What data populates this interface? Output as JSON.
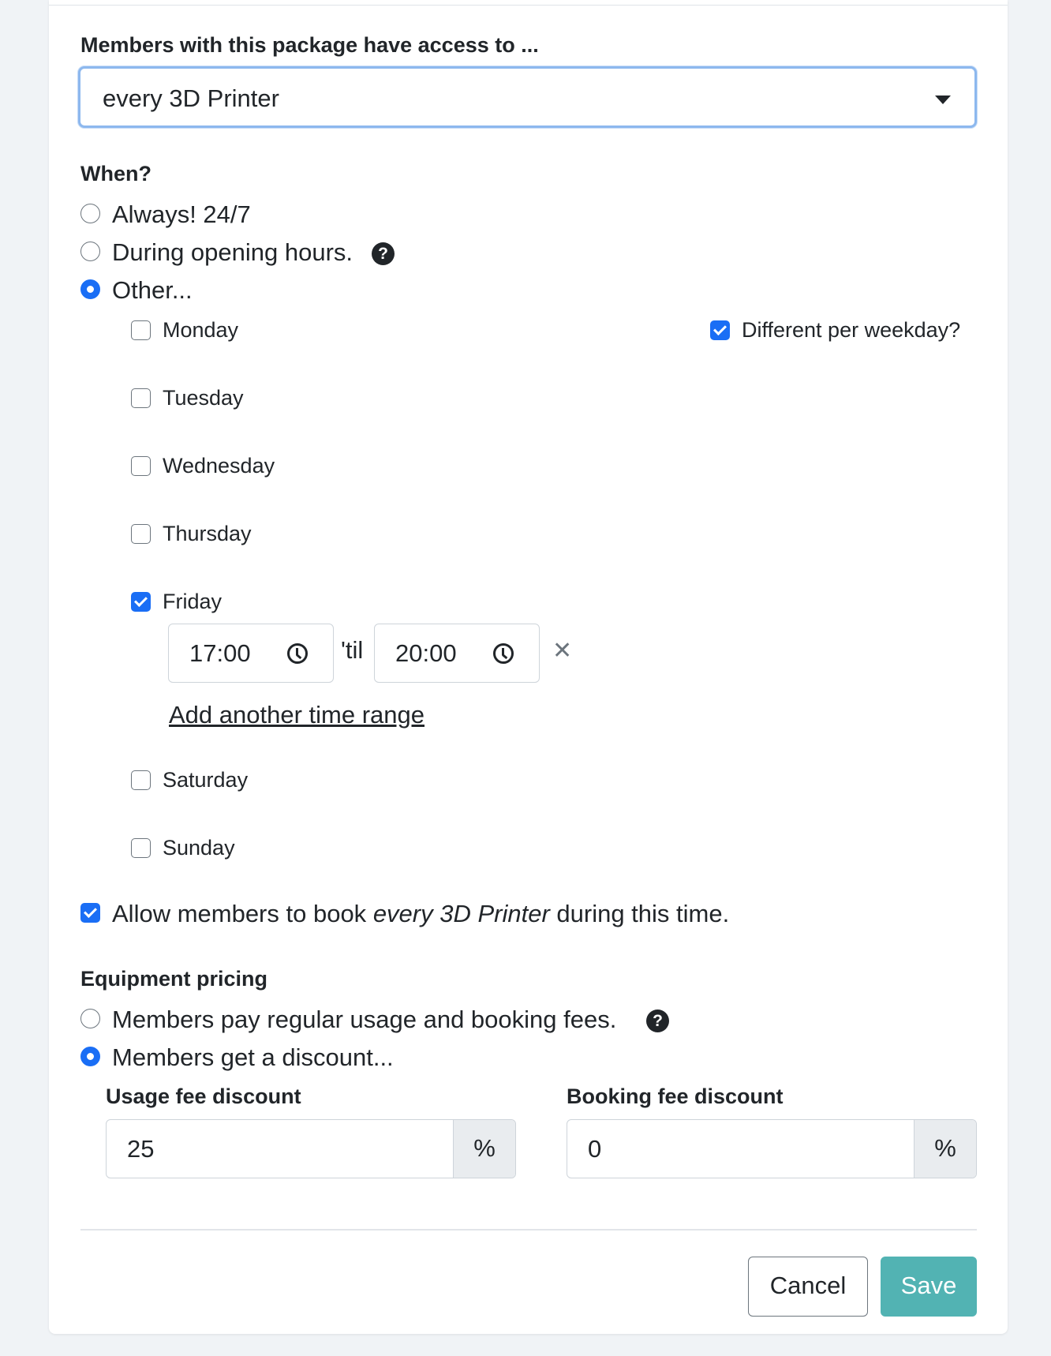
{
  "access": {
    "label": "Members with this package have access to ...",
    "selected": "every 3D Printer"
  },
  "when": {
    "label": "When?",
    "options": [
      "Always! 24/7",
      "During opening hours.",
      "Other..."
    ],
    "selected": "Other..."
  },
  "weekdays": {
    "different_label": "Different per weekday?",
    "different_checked": true,
    "days": [
      {
        "name": "Monday",
        "checked": false
      },
      {
        "name": "Tuesday",
        "checked": false
      },
      {
        "name": "Wednesday",
        "checked": false
      },
      {
        "name": "Thursday",
        "checked": false
      },
      {
        "name": "Friday",
        "checked": true
      },
      {
        "name": "Saturday",
        "checked": false
      },
      {
        "name": "Sunday",
        "checked": false
      }
    ],
    "friday_range": {
      "from": "17:00",
      "til_label": "'til",
      "to": "20:00"
    },
    "add_range_label": "Add another time range"
  },
  "booking": {
    "prefix": "Allow members to book ",
    "item": "every 3D Printer",
    "suffix": " during this time.",
    "checked": true
  },
  "pricing": {
    "label": "Equipment pricing",
    "options": [
      "Members pay regular usage and booking fees.",
      "Members get a discount..."
    ],
    "selected": "Members get a discount...",
    "usage_label": "Usage fee discount",
    "usage_value": "25",
    "booking_label": "Booking fee discount",
    "booking_value": "0",
    "unit": "%"
  },
  "actions": {
    "cancel": "Cancel",
    "save": "Save"
  },
  "colors": {
    "accent": "#1a6ef5",
    "save": "#52b3b3",
    "focus_border": "#8db8ee"
  }
}
